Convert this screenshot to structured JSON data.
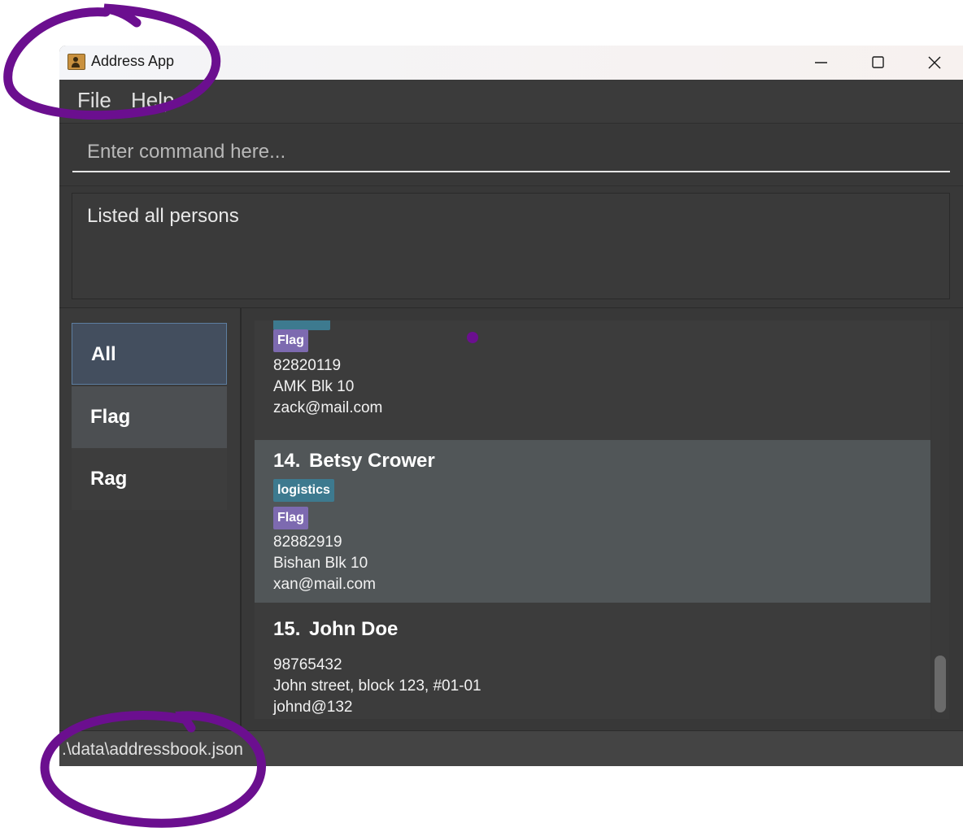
{
  "window": {
    "title": "Address App"
  },
  "menu": {
    "file": "File",
    "help": "Help"
  },
  "command": {
    "placeholder": "Enter command here..."
  },
  "result": {
    "message": "Listed all persons"
  },
  "filters": [
    {
      "label": "All",
      "selected": true
    },
    {
      "label": "Flag",
      "selected": false
    },
    {
      "label": "Rag",
      "selected": false
    }
  ],
  "persons": [
    {
      "tag": "Flag",
      "phone": "82820119",
      "address": "AMK Blk 10",
      "email": "zack@mail.com"
    },
    {
      "index": "14.",
      "name": "Betsy Crower",
      "tags": [
        "logistics",
        "Flag"
      ],
      "phone": "82882919",
      "address": "Bishan Blk 10",
      "email": "xan@mail.com",
      "selected": true
    },
    {
      "index": "15.",
      "name": "John Doe",
      "phone": "98765432",
      "address": "John street, block 123, #01-01",
      "email": "johnd@132"
    }
  ],
  "status": {
    "path": ".\\data\\addressbook.json"
  },
  "colors": {
    "accent_tag_logistics": "#3d7a8f",
    "accent_tag_flag": "#7d6ab0",
    "annotation": "#6b0f8f"
  }
}
